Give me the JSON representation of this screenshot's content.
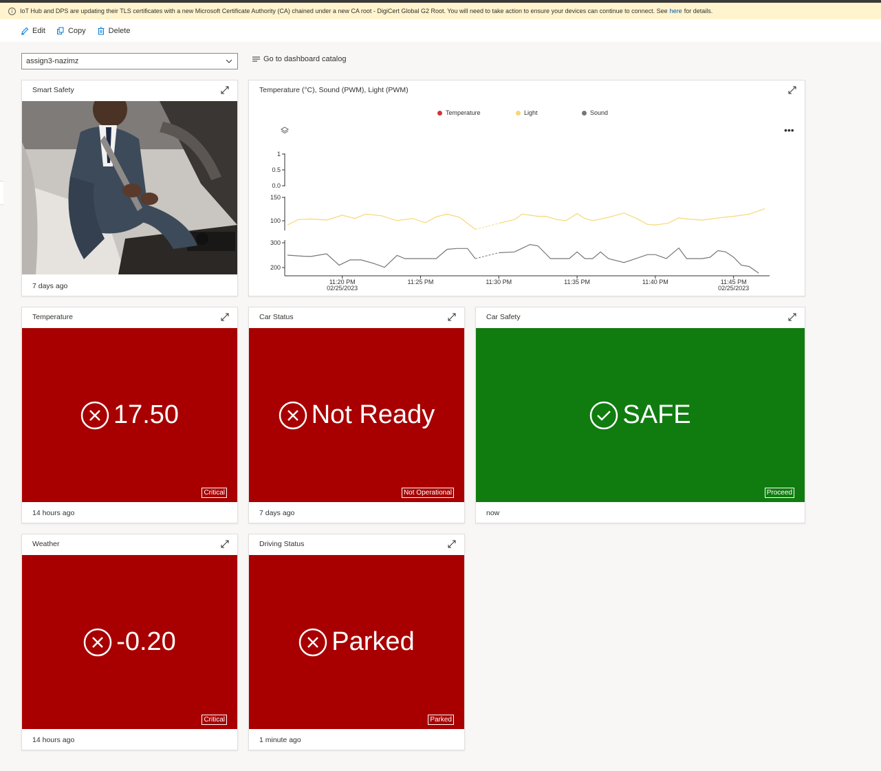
{
  "banner": {
    "text_before": "IoT Hub and DPS are updating their TLS certificates with a new Microsoft Certificate Authority (CA) chained under a new CA root - DigiCert Global G2 Root. You will need to take action to ensure your devices can continue to connect. See",
    "link": "here",
    "text_after": "for details."
  },
  "toolbar": {
    "edit_label": "Edit",
    "copy_label": "Copy",
    "delete_label": "Delete"
  },
  "dashboard_selector": {
    "value": "assign3-nazimz"
  },
  "catalog_link": "Go to dashboard catalog",
  "tiles": {
    "smart_safety": {
      "title": "Smart Safety",
      "footer": "7 days ago"
    },
    "chart": {
      "title": "Temperature (°C), Sound (PWM), Light (PWM)",
      "legend": [
        {
          "name": "Temperature",
          "color": "#d13438"
        },
        {
          "name": "Light",
          "color": "#f7d774"
        },
        {
          "name": "Sound",
          "color": "#7a7574"
        }
      ]
    },
    "temperature": {
      "title": "Temperature",
      "value": "17.50",
      "badge": "Critical",
      "footer": "14 hours ago",
      "status": "red"
    },
    "car_status": {
      "title": "Car Status",
      "value": "Not Ready",
      "badge": "Not Operational",
      "footer": "7 days ago",
      "status": "red"
    },
    "car_safety": {
      "title": "Car Safety",
      "value": "SAFE",
      "badge": "Proceed",
      "footer": "now",
      "status": "green"
    },
    "weather": {
      "title": "Weather",
      "value": "-0.20",
      "badge": "Critical",
      "footer": "14 hours ago",
      "status": "red"
    },
    "driving_status": {
      "title": "Driving Status",
      "value": "Parked",
      "badge": "Parked",
      "footer": "1 minute ago",
      "status": "red"
    }
  },
  "colors": {
    "critical": "#a80000",
    "safe": "#107c10",
    "link": "#0058ad"
  },
  "chart_data": {
    "type": "line",
    "title": "Temperature (°C), Sound (PWM), Light (PWM)",
    "x_ticks": [
      {
        "label": "11:20 PM",
        "sublabel": "02/25/2023",
        "minute": 20
      },
      {
        "label": "11:25 PM",
        "sublabel": "",
        "minute": 25
      },
      {
        "label": "11:30 PM",
        "sublabel": "",
        "minute": 30
      },
      {
        "label": "11:35 PM",
        "sublabel": "",
        "minute": 35
      },
      {
        "label": "11:40 PM",
        "sublabel": "",
        "minute": 40
      },
      {
        "label": "11:45 PM",
        "sublabel": "02/25/2023",
        "minute": 45
      }
    ],
    "xlim_minutes": [
      16.5,
      47.3
    ],
    "panels": [
      {
        "series": "Temperature",
        "ticks": [
          "1",
          "0.5",
          "0.0"
        ],
        "ylim": [
          0,
          1
        ],
        "values": []
      },
      {
        "series": "Light",
        "ticks": [
          "150",
          "100"
        ],
        "ylim": [
          90,
          152
        ],
        "minutes": [
          16.5,
          17.2,
          18.0,
          19.0,
          20.0,
          20.8,
          21.5,
          22.5,
          23.5,
          24.5,
          25.3,
          26.0,
          26.7,
          27.5,
          28.5,
          30.0,
          31.0,
          31.5,
          32.5,
          33.0,
          33.7,
          34.3,
          35.0,
          35.5,
          36.0,
          37.0,
          38.0,
          38.8,
          39.5,
          40.0,
          40.8,
          41.5,
          42.0,
          43.0,
          44.0,
          45.0,
          46.0,
          47.0
        ],
        "values": [
          100,
          110,
          111,
          109,
          118,
          112,
          120,
          117,
          108,
          112,
          104,
          115,
          120,
          114,
          92,
          103,
          110,
          120,
          116,
          116,
          110,
          108,
          121,
          112,
          108,
          114,
          122,
          112,
          101,
          100,
          103,
          113,
          111,
          109,
          113,
          116,
          120,
          130
        ],
        "gap_minutes": [
          28.5,
          30.0
        ]
      },
      {
        "series": "Sound",
        "ticks": [
          "300",
          "200"
        ],
        "ylim": [
          175,
          310
        ],
        "minutes": [
          16.5,
          17.5,
          18.0,
          19.0,
          19.8,
          20.5,
          21.2,
          22.0,
          22.7,
          23.5,
          24.0,
          25.0,
          26.0,
          26.7,
          27.3,
          28.0,
          28.5,
          30.0,
          31.0,
          32.0,
          32.5,
          33.3,
          34.0,
          34.5,
          35.0,
          35.5,
          36.0,
          36.5,
          37.0,
          38.0,
          38.5,
          39.5,
          40.0,
          40.7,
          41.5,
          42.0,
          43.0,
          43.5,
          44.0,
          44.5,
          45.0,
          45.5,
          46.0,
          46.6
        ],
        "values": [
          253,
          249,
          248,
          258,
          215,
          235,
          235,
          222,
          207,
          252,
          240,
          240,
          240,
          275,
          278,
          278,
          240,
          262,
          265,
          293,
          288,
          240,
          240,
          240,
          265,
          240,
          240,
          265,
          240,
          225,
          235,
          255,
          255,
          240,
          280,
          240,
          240,
          245,
          270,
          265,
          245,
          215,
          210,
          185
        ],
        "gap_minutes": [
          28.5,
          30.0
        ]
      }
    ]
  }
}
